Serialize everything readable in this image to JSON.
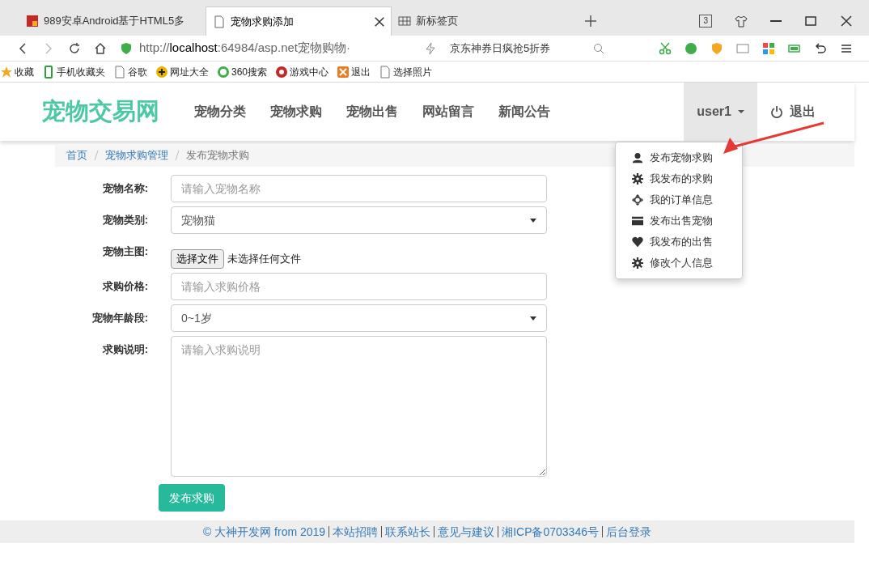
{
  "browser": {
    "tabs": [
      {
        "title": "989安卓Android基于HTML5多",
        "selected": false,
        "kind": "site"
      },
      {
        "title": "宠物求购添加",
        "selected": true,
        "kind": "page"
      },
      {
        "title": "新标签页",
        "selected": false,
        "kind": "grid"
      }
    ],
    "tab_count": "3",
    "address": {
      "prefix": "http://",
      "host": "localhost",
      "rest": ":64984/asp.net宠物购物·"
    },
    "search_hint": "京东神券日疯抢5折券",
    "bookmarks": [
      {
        "label": "收藏",
        "kind": "star"
      },
      {
        "label": "手机收藏夹",
        "kind": "phone"
      },
      {
        "label": "谷歌",
        "kind": "page"
      },
      {
        "label": "网址大全",
        "kind": "plus"
      },
      {
        "label": "360搜索",
        "kind": "ring"
      },
      {
        "label": "游戏中心",
        "kind": "game"
      },
      {
        "label": "退出",
        "kind": "box"
      },
      {
        "label": "选择照片",
        "kind": "page"
      }
    ]
  },
  "navbar": {
    "brand": "宠物交易网",
    "links": [
      "宠物分类",
      "宠物求购",
      "宠物出售",
      "网站留言",
      "新闻公告"
    ],
    "user": "user1",
    "logout": "退出",
    "user_menu": {
      "expanded": true,
      "items": [
        {
          "label": "发布宠物求购",
          "kind": "user"
        },
        {
          "label": "我发布的求购",
          "kind": "gear"
        },
        {
          "label": "我的订单信息",
          "kind": "move"
        },
        {
          "label": "发布出售宠物",
          "kind": "card"
        },
        {
          "label": "我发布的出售",
          "kind": "heart"
        },
        {
          "label": "修改个人信息",
          "kind": "gear"
        }
      ]
    }
  },
  "breadcrumb": [
    {
      "label": "首页",
      "link": true
    },
    {
      "label": "宠物求购管理",
      "link": true
    },
    {
      "label": "发布宠物求购",
      "link": false
    }
  ],
  "form": {
    "fields": [
      {
        "label": "宠物名称:",
        "kind": "text",
        "placeholder": "请输入宠物名称"
      },
      {
        "label": "宠物类别:",
        "kind": "select",
        "value": "宠物猫"
      },
      {
        "label": "宠物主图:",
        "kind": "file",
        "button": "选择文件",
        "value": "未选择任何文件"
      },
      {
        "label": "求购价格:",
        "kind": "text",
        "placeholder": "请输入求购价格"
      },
      {
        "label": "宠物年龄段:",
        "kind": "select",
        "value": "0~1岁"
      },
      {
        "label": "求购说明:",
        "kind": "textarea",
        "placeholder": "请输入求购说明"
      }
    ],
    "submit": "发布求购"
  },
  "footer": [
    "© 大神开发网 from 2019",
    "本站招聘",
    "联系站长",
    "意见与建议",
    "湘ICP备0703346号",
    "后台登录"
  ]
}
